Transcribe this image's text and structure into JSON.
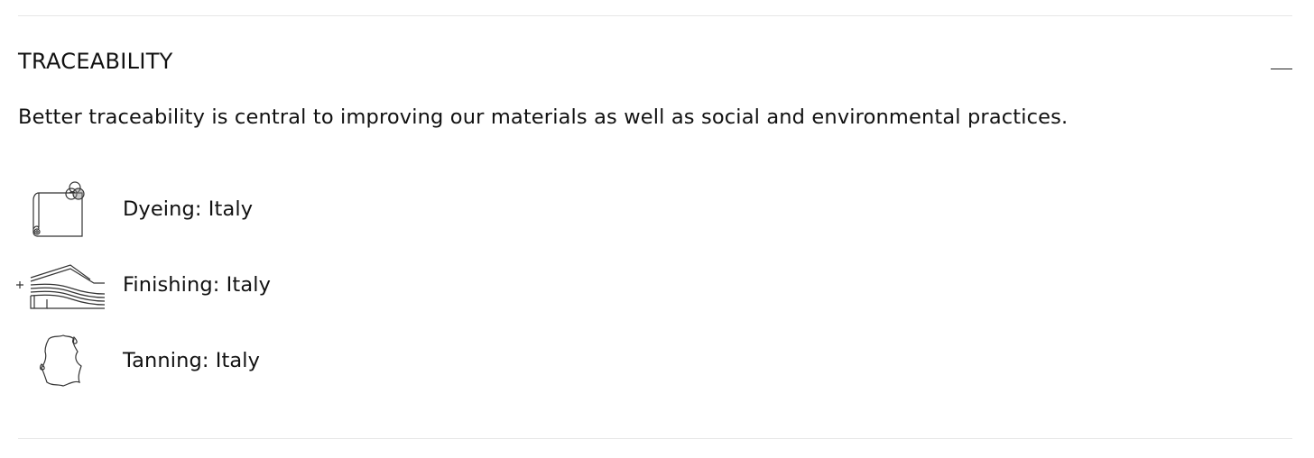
{
  "section": {
    "title": "TRACEABILITY",
    "toggle_icon": "minus-icon",
    "description": "Better traceability is central to improving our materials as well as social and environmental practices."
  },
  "traceability_items": [
    {
      "label": "Dyeing: Italy",
      "icon": "dyeing-fabric-roll-icon"
    },
    {
      "label": "Finishing: Italy",
      "icon": "finishing-layers-icon"
    },
    {
      "label": "Tanning: Italy",
      "icon": "tanning-hide-icon"
    }
  ],
  "colors": {
    "text": "#111111",
    "divider": "#e6e6e6",
    "icon_stroke": "#333333"
  }
}
